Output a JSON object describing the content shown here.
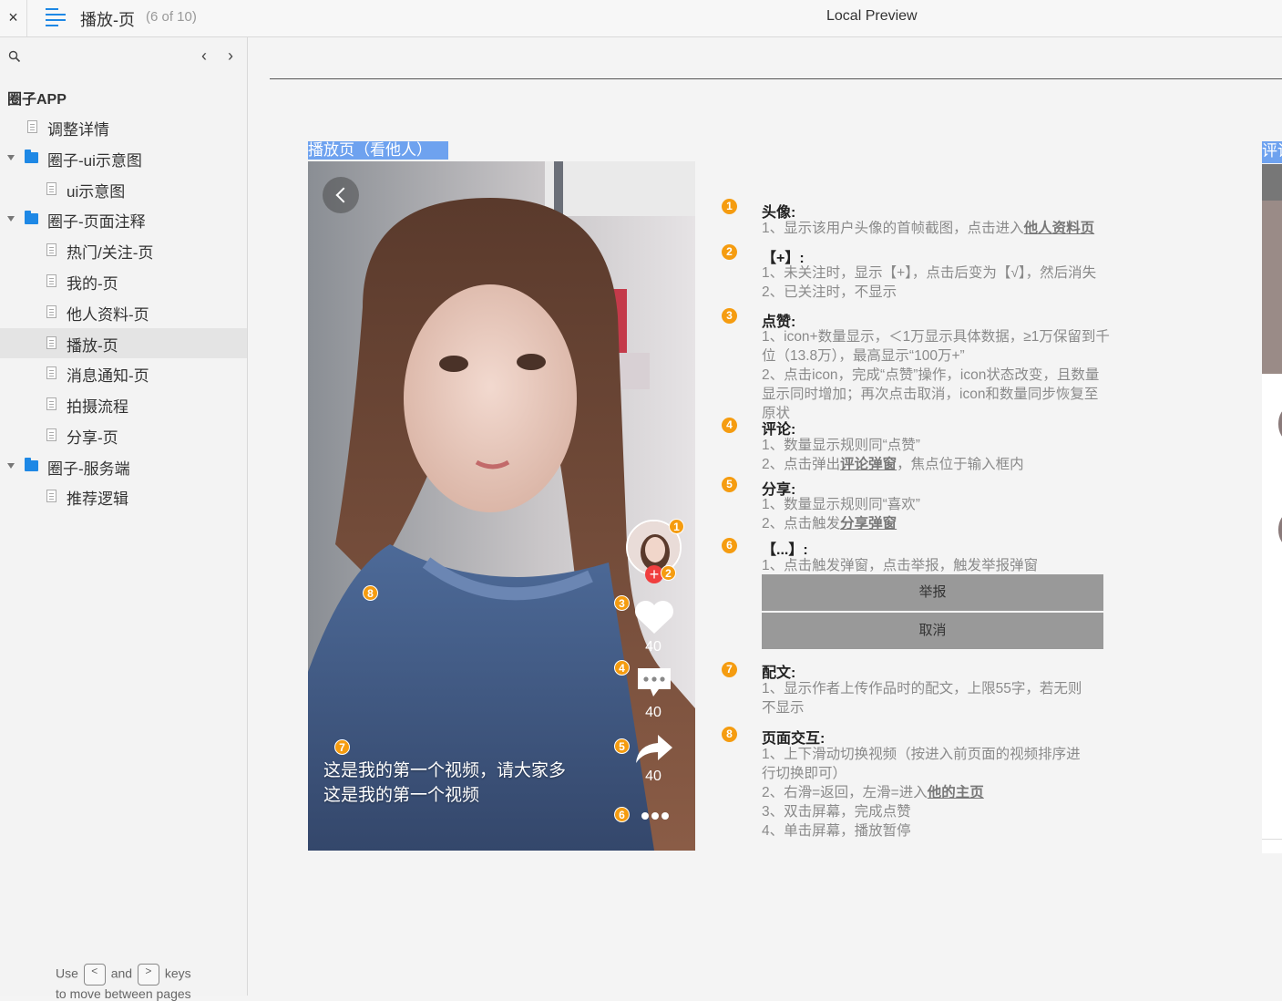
{
  "topbar": {
    "close": "×",
    "title": "播放-页",
    "count": "(6 of 10)",
    "preview": "Local Preview"
  },
  "sidebar": {
    "project": "圈子APP",
    "items": [
      {
        "label": "调整详情",
        "type": "page",
        "level": 0
      },
      {
        "label": "圈子-ui示意图",
        "type": "folder",
        "level": 0
      },
      {
        "label": "ui示意图",
        "type": "page",
        "level": 1
      },
      {
        "label": "圈子-页面注释",
        "type": "folder",
        "level": 0
      },
      {
        "label": "热门/关注-页",
        "type": "page",
        "level": 1
      },
      {
        "label": "我的-页",
        "type": "page",
        "level": 1
      },
      {
        "label": "他人资料-页",
        "type": "page",
        "level": 1
      },
      {
        "label": "播放-页",
        "type": "page",
        "level": 1,
        "active": true
      },
      {
        "label": "消息通知-页",
        "type": "page",
        "level": 1
      },
      {
        "label": "拍摄流程",
        "type": "page",
        "level": 1
      },
      {
        "label": "分享-页",
        "type": "page",
        "level": 1
      },
      {
        "label": "圈子-服务端",
        "type": "folder",
        "level": 0
      },
      {
        "label": "推荐逻辑",
        "type": "page",
        "level": 1
      }
    ],
    "hint": {
      "use": "Use",
      "and": "and",
      "keys": "keys",
      "line2": "to move between pages",
      "key_prev": "<",
      "key_next": ">"
    }
  },
  "frame": {
    "title": "播放页（看他人）",
    "right_tab": "评论"
  },
  "phone": {
    "like_count": "40",
    "comment_count": "40",
    "share_count": "40",
    "plus": "+",
    "caption1": "这是我的第一个视频，请大家多",
    "caption2": "这是我的第一个视频",
    "badges": [
      "1",
      "2",
      "3",
      "4",
      "5",
      "6",
      "7",
      "8"
    ]
  },
  "notes": [
    {
      "n": "1",
      "head": "头像:",
      "lines": [
        "1、显示该用户头像的首帧截图，点击进入"
      ],
      "link": "他人资料页"
    },
    {
      "n": "2",
      "head": "【+】:",
      "lines": [
        "1、未关注时，显示【+】，点击后变为【√】，然后消失",
        "2、已关注时，不显示"
      ]
    },
    {
      "n": "3",
      "head": "点赞:",
      "lines": [
        "1、icon+数量显示，＜1万显示具体数据，≥1万保留到千",
        "位（13.8万），最高显示“100万+”",
        "2、点击icon，完成“点赞”操作，icon状态改变，且数量",
        "显示同时增加；再次点击取消，icon和数量同步恢复至",
        "原状"
      ]
    },
    {
      "n": "4",
      "head": "评论:",
      "lines": [
        "1、数量显示规则同“点赞”",
        "2、点击弹出"
      ],
      "link": "评论弹窗",
      "tail": "，焦点位于输入框内"
    },
    {
      "n": "5",
      "head": "分享:",
      "lines": [
        "1、数量显示规则同“喜欢”",
        "2、点击触发"
      ],
      "link": "分享弹窗"
    },
    {
      "n": "6",
      "head": "【...】:",
      "lines": [
        "1、点击触发弹窗，点击举报，触发举报弹窗"
      ]
    },
    {
      "n": "7",
      "head": "配文:",
      "lines": [
        "1、显示作者上传作品时的配文，上限55字，若无则",
        "不显示"
      ]
    },
    {
      "n": "8",
      "head": "页面交互:",
      "lines": [
        "1、上下滑动切换视频（按进入前页面的视频排序进",
        "行切换即可）",
        "2、右滑=返回，左滑=进入",
        "3、双击屏幕，完成点赞",
        "4、单击屏幕，播放暂停"
      ],
      "link": "他的主页"
    }
  ],
  "sheet": {
    "report": "举报",
    "cancel": "取消"
  },
  "colors": {
    "accent": "#1e88e5",
    "badge": "#f59c10",
    "highlight": "#6ea2ef"
  }
}
